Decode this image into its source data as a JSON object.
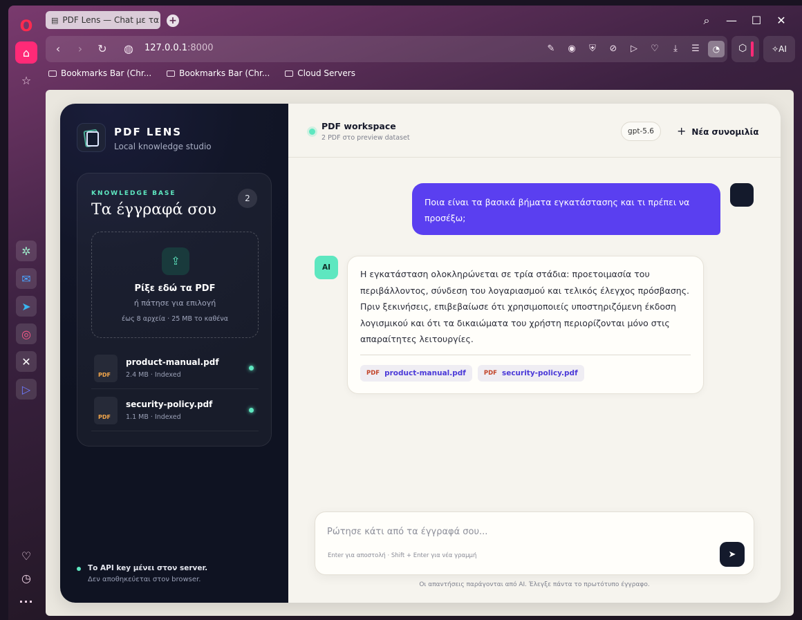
{
  "browser": {
    "tab_title": "PDF Lens — Chat με τα έγ",
    "url_host": "127.0.0.1",
    "url_port": ":8000",
    "ai_label": "AI",
    "bookmarks": [
      "Bookmarks Bar (Chr...",
      "Bookmarks Bar (Chr...",
      "Cloud Servers"
    ],
    "accent_color": "#ff2a77"
  },
  "sidebar": {
    "brand_title": "PDF LENS",
    "brand_subtitle": "Local knowledge studio",
    "kb_label": "KNOWLEDGE BASE",
    "kb_title": "Τα έγγραφά σου",
    "kb_count": "2",
    "dropzone": {
      "title": "Ρίξε εδώ τα PDF",
      "subtitle": "ή πάτησε για επιλογή",
      "limit": "έως 8 αρχεία · 25 MB το καθένα"
    },
    "files": [
      {
        "badge": "PDF",
        "name": "product-manual.pdf",
        "meta": "2.4 MB · Indexed"
      },
      {
        "badge": "PDF",
        "name": "security-policy.pdf",
        "meta": "1.1 MB · Indexed"
      }
    ],
    "api_title": "Το API key μένει στον server.",
    "api_subtitle": "Δεν αποθηκεύεται στον browser."
  },
  "chat": {
    "workspace_title": "PDF workspace",
    "workspace_subtitle": "2 PDF στο preview dataset",
    "model": "gpt-5.6",
    "new_chat": "Νέα συνομιλία",
    "user_message": "Ποια είναι τα βασικά βήματα εγκατάστασης και τι πρέπει να προσέξω;",
    "ai_avatar": "AI",
    "ai_message": "Η εγκατάσταση ολοκληρώνεται σε τρία στάδια: προετοιμασία του περιβάλλοντος, σύνδεση του λογαριασμού και τελικός έλεγχος πρόσβασης. Πριν ξεκινήσεις, επιβεβαίωσε ότι χρησιμοποιείς υποστηριζόμενη έκδοση λογισμικού και ότι τα δικαιώματα του χρήστη περιορίζονται μόνο στις απαραίτητες λειτουργίες.",
    "sources": [
      {
        "badge": "PDF",
        "name": "product-manual.pdf"
      },
      {
        "badge": "PDF",
        "name": "security-policy.pdf"
      }
    ],
    "composer_placeholder": "Ρώτησε κάτι από τα έγγραφά σου...",
    "composer_hint": "Enter για αποστολή · Shift + Enter για νέα γραμμή",
    "disclaimer": "Οι απαντήσεις παράγονται από AI. Έλεγξε πάντα το πρωτότυπο έγγραφο.",
    "user_color": "#5a3ff0",
    "ai_accent": "#5ee7c0"
  }
}
